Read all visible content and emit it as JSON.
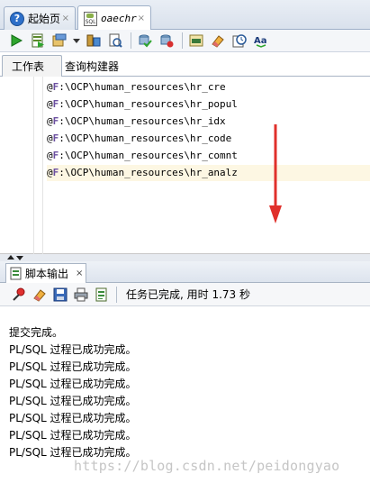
{
  "doc_tabs": {
    "start_tab": {
      "label": "起始页",
      "close": "×"
    },
    "active_tab": {
      "label": "oaechr",
      "close": "×"
    }
  },
  "editor_tabs": {
    "worksheet": "工作表",
    "query_builder": "查询构建器"
  },
  "editor": {
    "lines": [
      {
        "prefix": "@",
        "drive": "F",
        "rest": ":\\OCP\\human_resources\\hr_cre"
      },
      {
        "prefix": "@",
        "drive": "F",
        "rest": ":\\OCP\\human_resources\\hr_popul"
      },
      {
        "prefix": "@",
        "drive": "F",
        "rest": ":\\OCP\\human_resources\\hr_idx"
      },
      {
        "prefix": "@",
        "drive": "F",
        "rest": ":\\OCP\\human_resources\\hr_code"
      },
      {
        "prefix": "@",
        "drive": "F",
        "rest": ":\\OCP\\human_resources\\hr_comnt"
      },
      {
        "prefix": "@",
        "drive": "F",
        "rest": ":\\OCP\\human_resources\\hr_analz"
      }
    ],
    "annotation_color": "#e0302b",
    "current_line_color": "#fdf7e3"
  },
  "output_panel": {
    "tab_label": "脚本输出",
    "tab_close": "×",
    "status": "任务已完成, 用时 1.73 秒",
    "lines": [
      "提交完成。",
      "PL/SQL 过程已成功完成。",
      "PL/SQL 过程已成功完成。",
      "PL/SQL 过程已成功完成。",
      "PL/SQL 过程已成功完成。",
      "PL/SQL 过程已成功完成。",
      "PL/SQL 过程已成功完成。",
      "PL/SQL 过程已成功完成。"
    ],
    "watermark": "https://blog.csdn.net/peidongyao"
  },
  "toolbar_icons": [
    "run-statement-icon",
    "run-script-icon",
    "autotrace-icon",
    "explain-plan-icon",
    "sql-tuning-icon",
    "commit-icon",
    "rollback-icon",
    "unshared-sql-icon",
    "clear-icon",
    "history-icon",
    "format-case-icon"
  ],
  "output_toolbar_icons": [
    "pin-icon",
    "eraser-icon",
    "save-icon",
    "print-icon",
    "script-icon"
  ]
}
